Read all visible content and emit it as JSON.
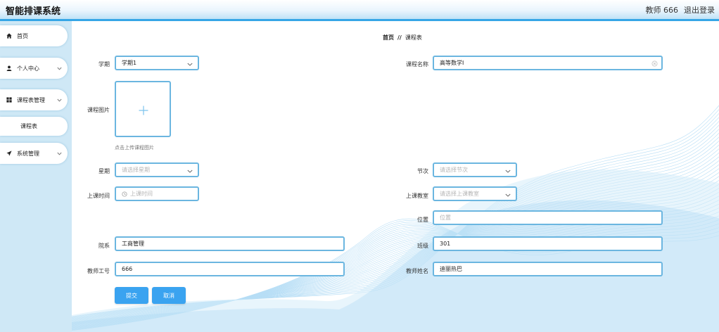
{
  "header": {
    "app_title": "智能排课系统",
    "user_label": "教师 666",
    "logout_label": "退出登录"
  },
  "sidebar": {
    "items": [
      {
        "label": "首页",
        "icon": "home-icon"
      },
      {
        "label": "个人中心",
        "icon": "user-icon"
      },
      {
        "label": "课程表管理",
        "icon": "grid-icon"
      },
      {
        "label": "课程表",
        "icon": ""
      },
      {
        "label": "系统管理",
        "icon": "send-icon"
      }
    ]
  },
  "breadcrumb": {
    "home": "首页",
    "separator": "//",
    "current": "课程表"
  },
  "form": {
    "term": {
      "label": "学期",
      "value": "学期1"
    },
    "course_name": {
      "label": "课程名称",
      "value": "高等数学I"
    },
    "course_image": {
      "label": "课程图片",
      "hint": "点击上传课程图片"
    },
    "weekday": {
      "label": "星期",
      "placeholder": "请选择星期"
    },
    "period": {
      "label": "节次",
      "placeholder": "请选择节次"
    },
    "class_time": {
      "label": "上课时间",
      "placeholder": "上课时间"
    },
    "classroom": {
      "label": "上课教室",
      "placeholder": "请选择上课教室"
    },
    "location": {
      "label": "位置",
      "placeholder": "位置"
    },
    "department": {
      "label": "院系",
      "value": "工商管理"
    },
    "class_group": {
      "label": "班级",
      "value": "301"
    },
    "teacher_id": {
      "label": "教师工号",
      "value": "666"
    },
    "teacher_name": {
      "label": "教师姓名",
      "value": "迪丽热巴"
    }
  },
  "buttons": {
    "submit": "提交",
    "cancel": "取消"
  },
  "colors": {
    "accent": "#3aa3f0",
    "border": "#6bb6e0",
    "sidebar_bg": "#cfe8f6"
  }
}
